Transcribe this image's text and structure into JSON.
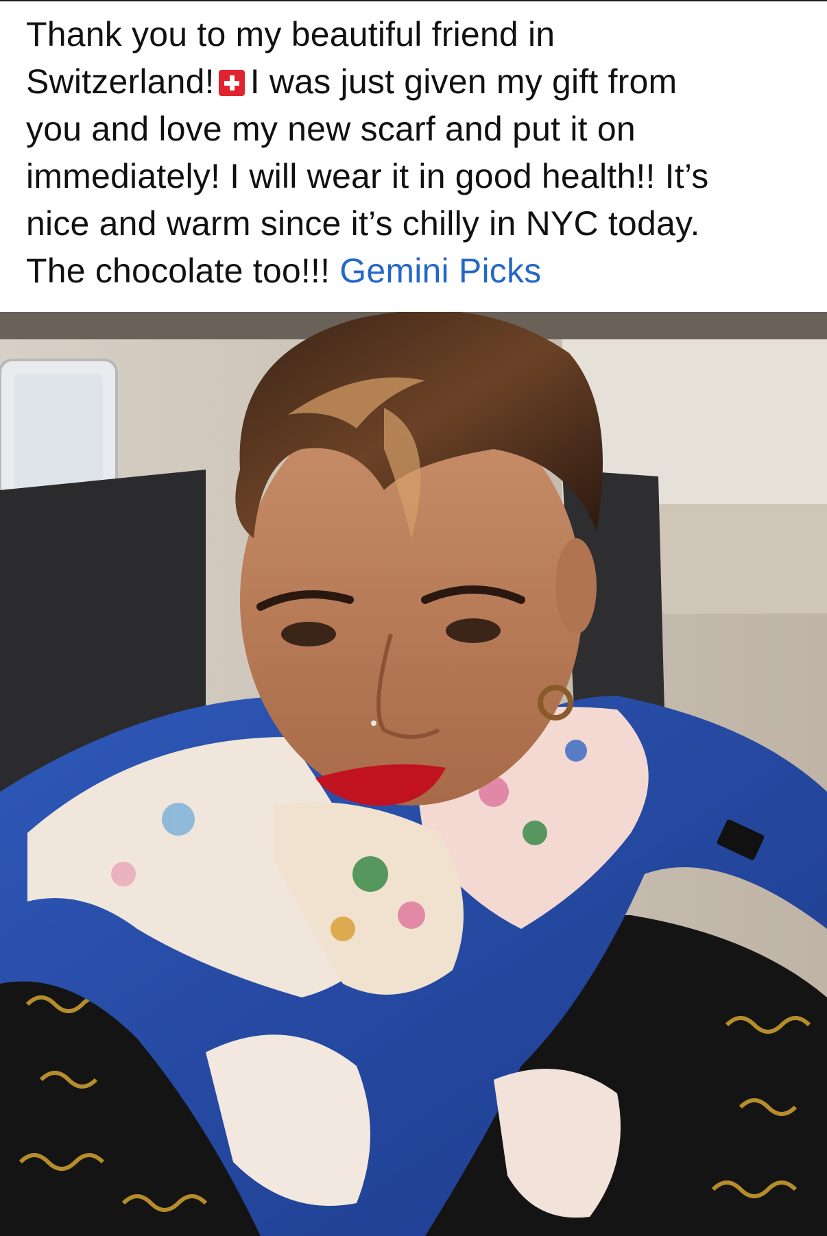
{
  "post": {
    "text_parts": {
      "line1": "Thank you to my beautiful friend in",
      "line2a": "Switzerland!",
      "line2b": "I was just given my gift from",
      "line3": "you and love my new scarf and put it on",
      "line4": "immediately! I will wear it in good health!! It’s",
      "line5": "nice and warm since it’s chilly in NYC today.",
      "line6": "The chocolate too!!!"
    },
    "tag_link": "Gemini Picks",
    "emoji": "switzerland-flag",
    "link_color": "#2467c8"
  },
  "photo": {
    "subject": "selfie-woman-blue-floral-scarf"
  }
}
